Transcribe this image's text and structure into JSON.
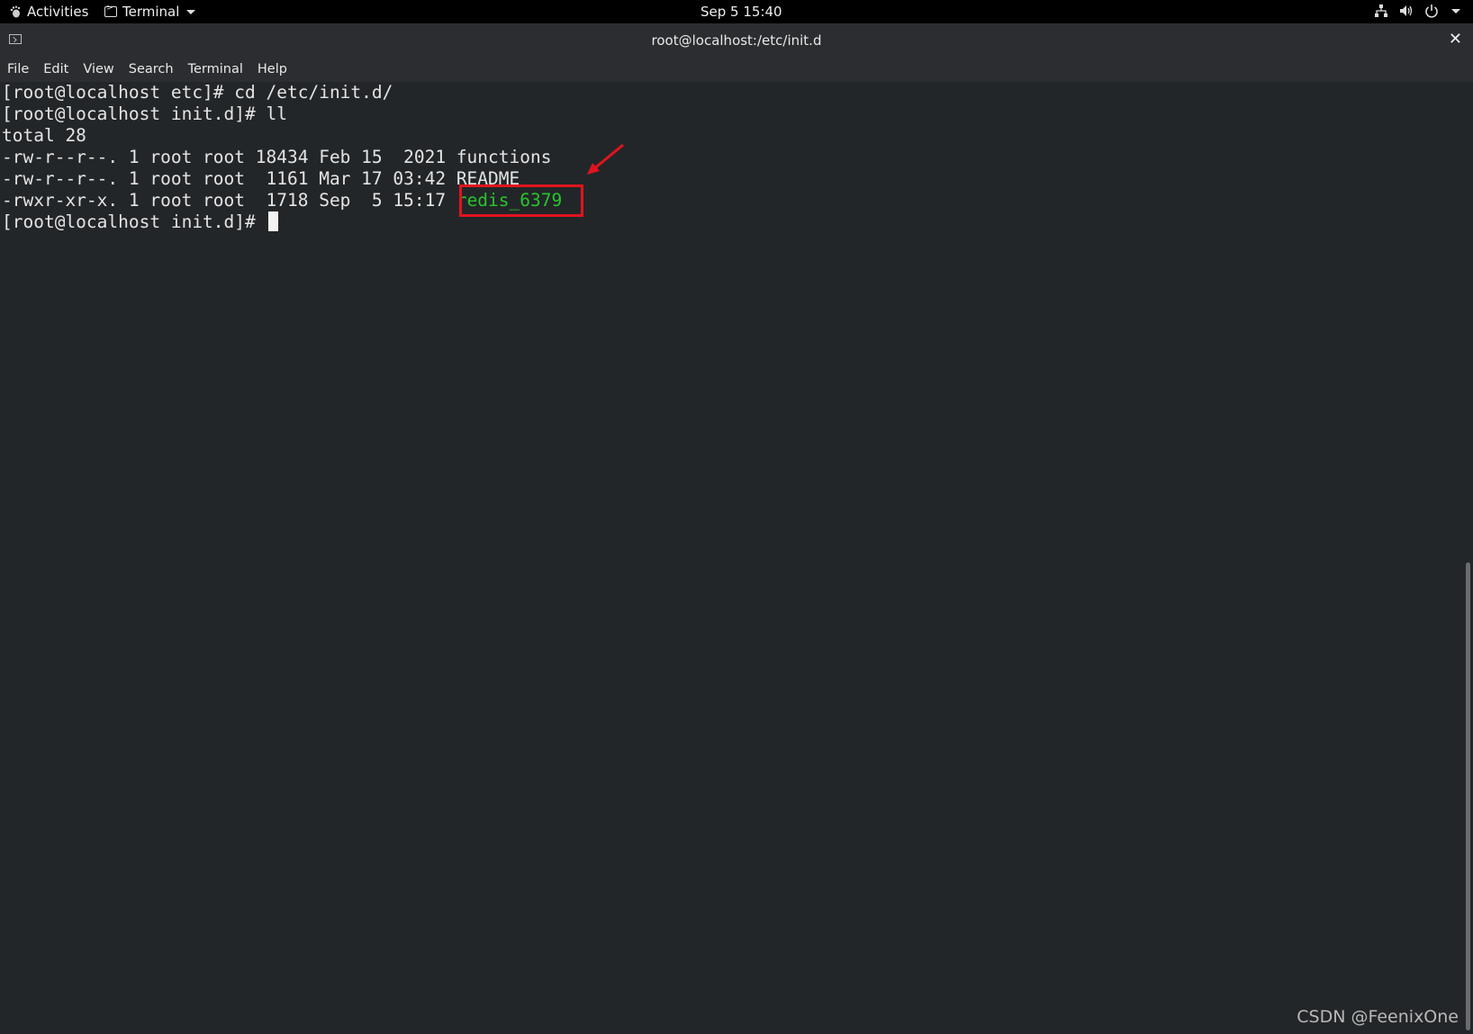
{
  "topbar": {
    "activities": "Activities",
    "app_menu": "Terminal",
    "clock": "Sep 5  15:40"
  },
  "window": {
    "title": "root@localhost:/etc/init.d"
  },
  "menu": [
    "File",
    "Edit",
    "View",
    "Search",
    "Terminal",
    "Help"
  ],
  "terminal": {
    "lines": [
      "[root@localhost etc]# cd /etc/init.d/",
      "[root@localhost init.d]# ll",
      "total 28",
      "-rw-r--r--. 1 root root 18434 Feb 15  2021 functions",
      "-rw-r--r--. 1 root root  1161 Mar 17 03:42 README"
    ],
    "redis_line_prefix": "-rwxr-xr-x. 1 root root  1718 Sep  5 15:17 ",
    "redis_file": "redis_6379",
    "prompt": "[root@localhost init.d]# "
  },
  "colors": {
    "terminal_bg": "#232629",
    "executable_green": "#26c62a",
    "annotation_red": "#e0141e"
  },
  "watermark": "CSDN @FeenixOne"
}
